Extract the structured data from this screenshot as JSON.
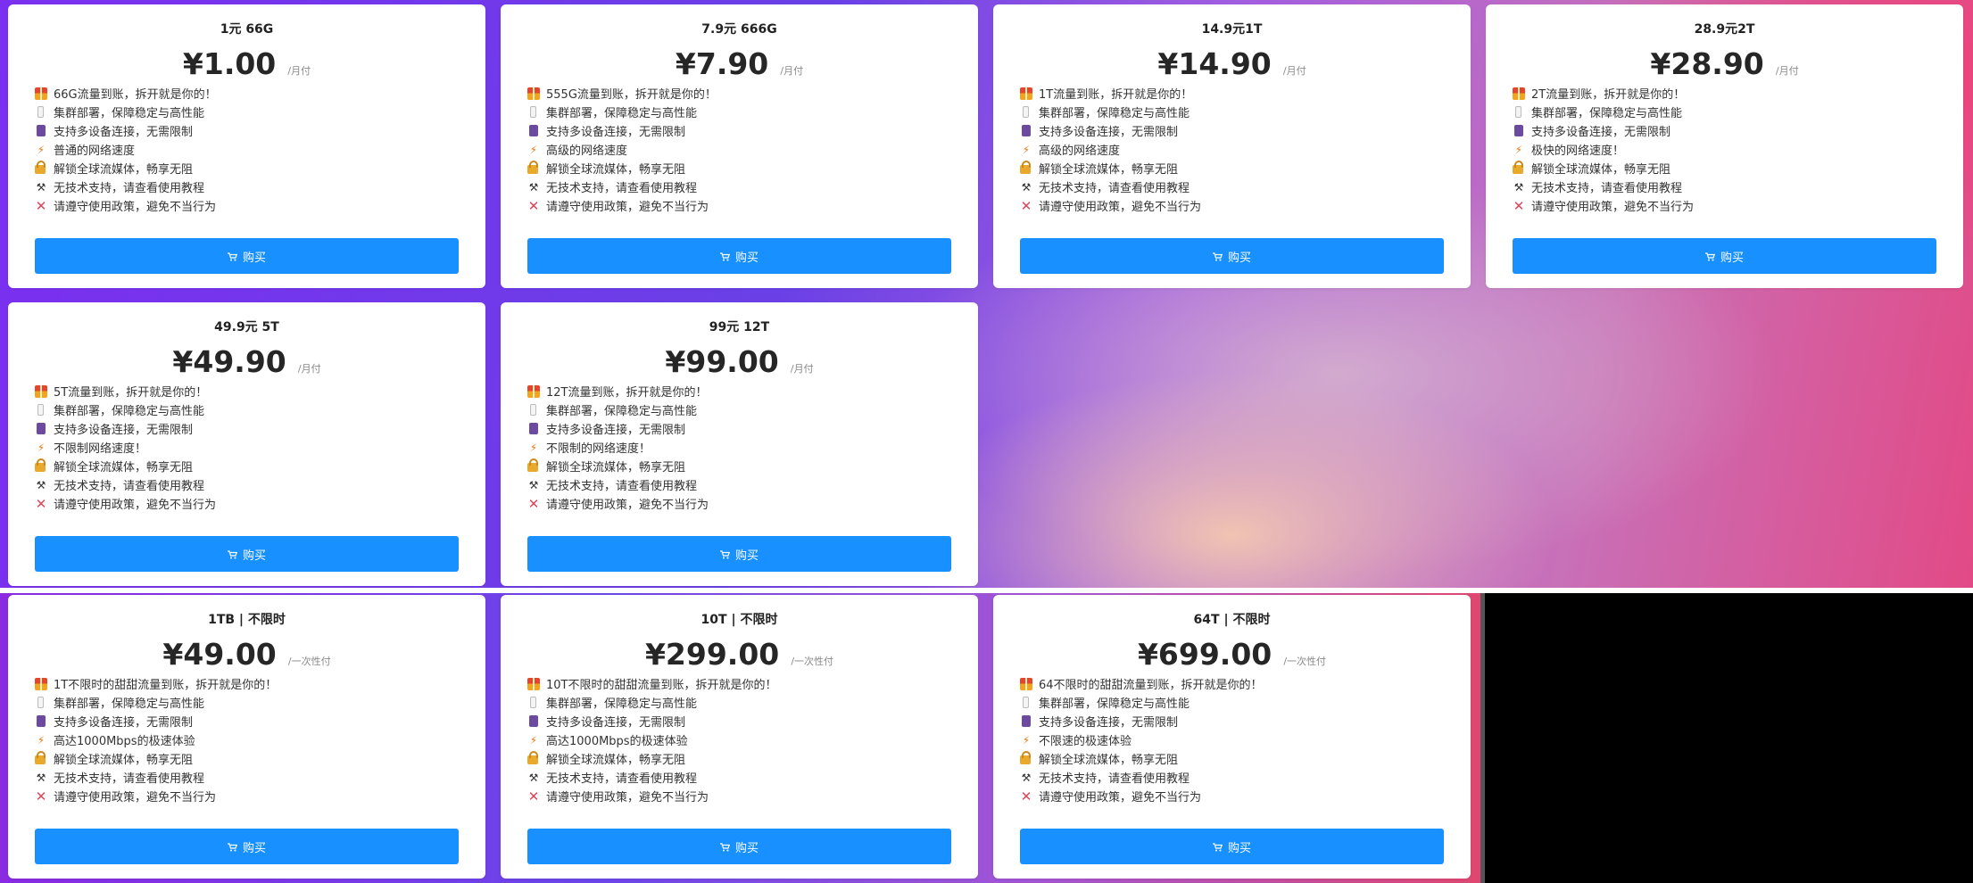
{
  "buy_label": "购买",
  "plans": [
    {
      "title": "1元 66G",
      "price": "¥1.00",
      "period": "/月付",
      "features": [
        {
          "icon": "gift-icon",
          "text": "66G流量到账，拆开就是你的！"
        },
        {
          "icon": "phone-icon",
          "text": "集群部署，保障稳定与高性能"
        },
        {
          "icon": "device-icon",
          "text": "支持多设备连接，无需限制"
        },
        {
          "icon": "bolt-icon",
          "text": "普通的网络速度"
        },
        {
          "icon": "unlock-icon",
          "text": "解锁全球流媒体，畅享无阻"
        },
        {
          "icon": "tools-icon",
          "text": "无技术支持，请查看使用教程"
        },
        {
          "icon": "cross-icon",
          "text": "请遵守使用政策，避免不当行为"
        }
      ]
    },
    {
      "title": "7.9元 666G",
      "price": "¥7.90",
      "period": "/月付",
      "features": [
        {
          "icon": "gift-icon",
          "text": "555G流量到账，拆开就是你的！"
        },
        {
          "icon": "phone-icon",
          "text": "集群部署，保障稳定与高性能"
        },
        {
          "icon": "device-icon",
          "text": "支持多设备连接，无需限制"
        },
        {
          "icon": "bolt-icon",
          "text": "高级的网络速度"
        },
        {
          "icon": "unlock-icon",
          "text": "解锁全球流媒体，畅享无阻"
        },
        {
          "icon": "tools-icon",
          "text": "无技术支持，请查看使用教程"
        },
        {
          "icon": "cross-icon",
          "text": "请遵守使用政策，避免不当行为"
        }
      ]
    },
    {
      "title": "14.9元1T",
      "price": "¥14.90",
      "period": "/月付",
      "features": [
        {
          "icon": "gift-icon",
          "text": "1T流量到账，拆开就是你的！"
        },
        {
          "icon": "phone-icon",
          "text": "集群部署，保障稳定与高性能"
        },
        {
          "icon": "device-icon",
          "text": "支持多设备连接，无需限制"
        },
        {
          "icon": "bolt-icon",
          "text": "高级的网络速度"
        },
        {
          "icon": "unlock-icon",
          "text": "解锁全球流媒体，畅享无阻"
        },
        {
          "icon": "tools-icon",
          "text": "无技术支持，请查看使用教程"
        },
        {
          "icon": "cross-icon",
          "text": "请遵守使用政策，避免不当行为"
        }
      ]
    },
    {
      "title": "28.9元2T",
      "price": "¥28.90",
      "period": "/月付",
      "features": [
        {
          "icon": "gift-icon",
          "text": "2T流量到账，拆开就是你的！"
        },
        {
          "icon": "phone-icon",
          "text": "集群部署，保障稳定与高性能"
        },
        {
          "icon": "device-icon",
          "text": "支持多设备连接，无需限制"
        },
        {
          "icon": "bolt-icon",
          "text": "极快的网络速度！"
        },
        {
          "icon": "unlock-icon",
          "text": "解锁全球流媒体，畅享无阻"
        },
        {
          "icon": "tools-icon",
          "text": "无技术支持，请查看使用教程"
        },
        {
          "icon": "cross-icon",
          "text": "请遵守使用政策，避免不当行为"
        }
      ]
    },
    {
      "title": "49.9元 5T",
      "price": "¥49.90",
      "period": "/月付",
      "features": [
        {
          "icon": "gift-icon",
          "text": "5T流量到账，拆开就是你的！"
        },
        {
          "icon": "phone-icon",
          "text": "集群部署，保障稳定与高性能"
        },
        {
          "icon": "device-icon",
          "text": "支持多设备连接，无需限制"
        },
        {
          "icon": "bolt-icon",
          "text": "不限制网络速度！"
        },
        {
          "icon": "unlock-icon",
          "text": "解锁全球流媒体，畅享无阻"
        },
        {
          "icon": "tools-icon",
          "text": "无技术支持，请查看使用教程"
        },
        {
          "icon": "cross-icon",
          "text": "请遵守使用政策，避免不当行为"
        }
      ]
    },
    {
      "title": "99元 12T",
      "price": "¥99.00",
      "period": "/月付",
      "features": [
        {
          "icon": "gift-icon",
          "text": "12T流量到账，拆开就是你的！"
        },
        {
          "icon": "phone-icon",
          "text": "集群部署，保障稳定与高性能"
        },
        {
          "icon": "device-icon",
          "text": "支持多设备连接，无需限制"
        },
        {
          "icon": "bolt-icon",
          "text": "不限制的网络速度！"
        },
        {
          "icon": "unlock-icon",
          "text": "解锁全球流媒体，畅享无阻"
        },
        {
          "icon": "tools-icon",
          "text": "无技术支持，请查看使用教程"
        },
        {
          "icon": "cross-icon",
          "text": "请遵守使用政策，避免不当行为"
        }
      ]
    },
    {
      "title": "1TB | 不限时",
      "price": "¥49.00",
      "period": "/一次性付",
      "features": [
        {
          "icon": "gift-icon",
          "text": "1T不限时的甜甜流量到账，拆开就是你的！"
        },
        {
          "icon": "phone-icon",
          "text": "集群部署，保障稳定与高性能"
        },
        {
          "icon": "device-icon",
          "text": "支持多设备连接，无需限制"
        },
        {
          "icon": "bolt-icon",
          "text": "高达1000Mbps的极速体验"
        },
        {
          "icon": "unlock-icon",
          "text": "解锁全球流媒体，畅享无阻"
        },
        {
          "icon": "tools-icon",
          "text": "无技术支持，请查看使用教程"
        },
        {
          "icon": "cross-icon",
          "text": "请遵守使用政策，避免不当行为"
        }
      ]
    },
    {
      "title": "10T | 不限时",
      "price": "¥299.00",
      "period": "/一次性付",
      "features": [
        {
          "icon": "gift-icon",
          "text": "10T不限时的甜甜流量到账，拆开就是你的！"
        },
        {
          "icon": "phone-icon",
          "text": "集群部署，保障稳定与高性能"
        },
        {
          "icon": "device-icon",
          "text": "支持多设备连接，无需限制"
        },
        {
          "icon": "bolt-icon",
          "text": "高达1000Mbps的极速体验"
        },
        {
          "icon": "unlock-icon",
          "text": "解锁全球流媒体，畅享无阻"
        },
        {
          "icon": "tools-icon",
          "text": "无技术支持，请查看使用教程"
        },
        {
          "icon": "cross-icon",
          "text": "请遵守使用政策，避免不当行为"
        }
      ]
    },
    {
      "title": "64T | 不限时",
      "price": "¥699.00",
      "period": "/一次性付",
      "features": [
        {
          "icon": "gift-icon",
          "text": "64不限时的甜甜流量到账，拆开就是你的！"
        },
        {
          "icon": "phone-icon",
          "text": "集群部署，保障稳定与高性能"
        },
        {
          "icon": "device-icon",
          "text": "支持多设备连接，无需限制"
        },
        {
          "icon": "bolt-icon",
          "text": "不限速的极速体验"
        },
        {
          "icon": "unlock-icon",
          "text": "解锁全球流媒体，畅享无阻"
        },
        {
          "icon": "tools-icon",
          "text": "无技术支持，请查看使用教程"
        },
        {
          "icon": "cross-icon",
          "text": "请遵守使用政策，避免不当行为"
        }
      ]
    }
  ]
}
